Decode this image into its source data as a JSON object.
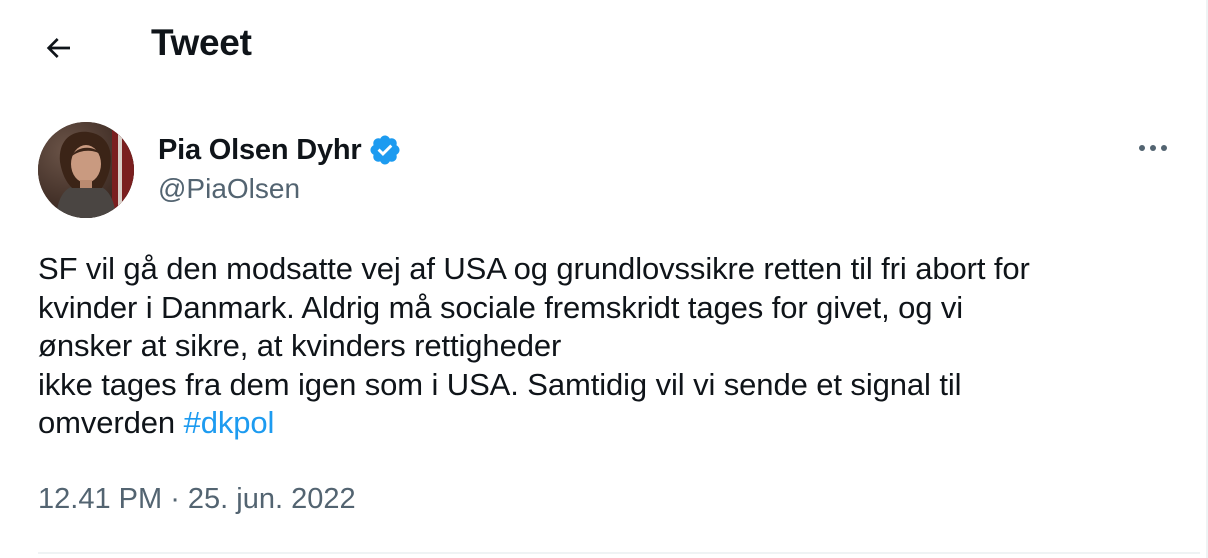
{
  "header": {
    "back_icon": "arrow-left-icon",
    "title": "Tweet"
  },
  "author": {
    "display_name": "Pia Olsen Dyhr",
    "handle": "@PiaOlsen",
    "verified_icon": "verified-badge-icon",
    "verified_color": "#1d9bf0"
  },
  "more_icon": "more-horizontal-icon",
  "tweet": {
    "lines": [
      "SF vil gå den modsatte vej af USA og grundlovssikre retten til fri abort for",
      "kvinder i Danmark. Aldrig må sociale fremskridt tages for givet, og vi",
      "ønsker at sikre, at kvinders rettigheder",
      "ikke tages fra dem igen som i USA. Samtidig vil vi sende et signal til"
    ],
    "last_line_prefix": "omverden ",
    "hashtag": "#dkpol",
    "hashtag_color": "#1d9bf0"
  },
  "timestamp": {
    "time": "12.41 PM",
    "separator": " · ",
    "date": "25. jun. 2022"
  }
}
